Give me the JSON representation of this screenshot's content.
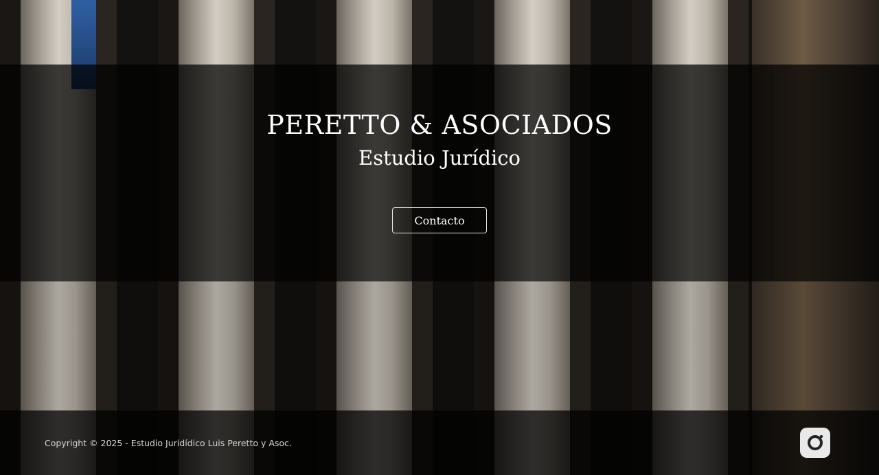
{
  "hero": {
    "title": "PERETTO & ASOCIADOS",
    "subtitle": "Estudio Jurídico",
    "contact_label": "Contacto"
  },
  "footer": {
    "copyright": "Copyright © 2025 - Estudio Juridídico Luis Peretto y Asoc.",
    "social_icon": "instagram-icon"
  },
  "colors": {
    "overlay": "#000000",
    "text": "#ffffff",
    "icon_bg": "#e9e9e9",
    "icon_fg": "#222222"
  }
}
